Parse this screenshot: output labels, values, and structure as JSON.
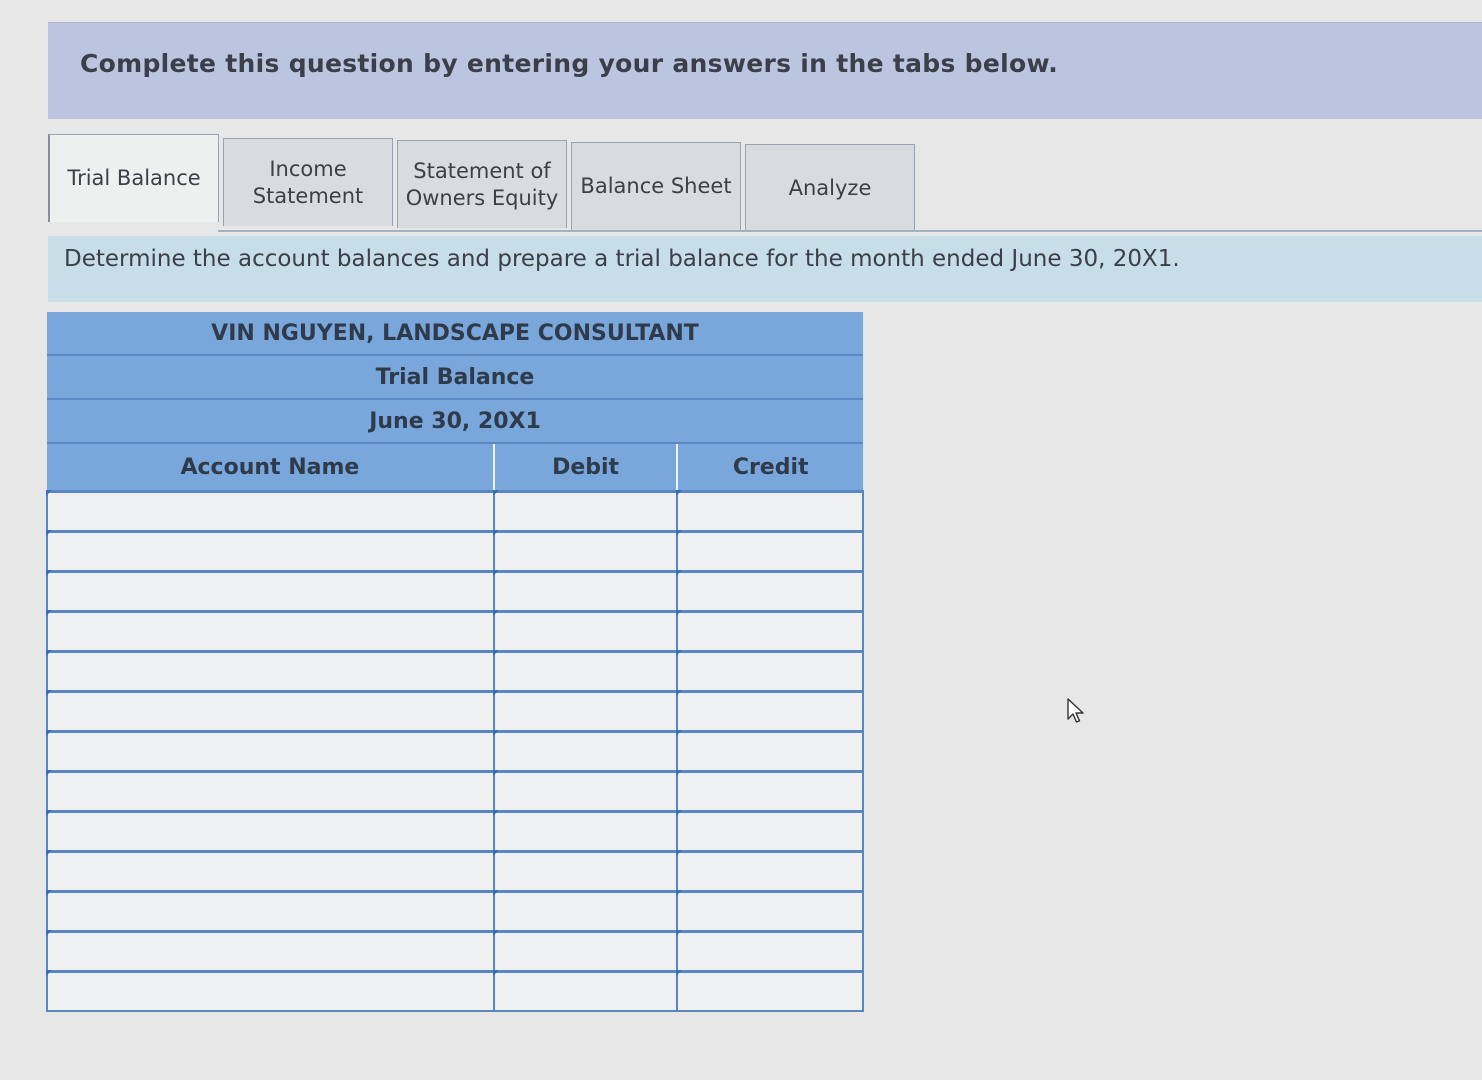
{
  "banner": {
    "text": "Complete this question by entering your answers in the tabs below."
  },
  "tabs": [
    {
      "label": "Trial Balance",
      "active": true
    },
    {
      "label": "Income\nStatement",
      "active": false
    },
    {
      "label": "Statement of\nOwners Equity",
      "active": false
    },
    {
      "label": "Balance Sheet",
      "active": false
    },
    {
      "label": "Analyze",
      "active": false
    }
  ],
  "instruction": "Determine the account balances and prepare a trial balance for the month ended June 30, 20X1.",
  "table": {
    "company": "VIN NGUYEN,  LANDSCAPE CONSULTANT",
    "title": "Trial Balance",
    "date": "June 30, 20X1",
    "columns": [
      "Account Name",
      "Debit",
      "Credit"
    ],
    "rows": [
      [
        "",
        "",
        ""
      ],
      [
        "",
        "",
        ""
      ],
      [
        "",
        "",
        ""
      ],
      [
        "",
        "",
        ""
      ],
      [
        "",
        "",
        ""
      ],
      [
        "",
        "",
        ""
      ],
      [
        "",
        "",
        ""
      ],
      [
        "",
        "",
        ""
      ],
      [
        "",
        "",
        ""
      ],
      [
        "",
        "",
        ""
      ],
      [
        "",
        "",
        ""
      ],
      [
        "",
        "",
        ""
      ],
      [
        "",
        "",
        ""
      ]
    ]
  },
  "colors": {
    "banner": "#bcc5df",
    "instruction_bar": "#c7dde8",
    "table_header": "#7aa7db",
    "grid_line": "#5b87c0"
  },
  "icons": {
    "cursor": "mouse-pointer-icon"
  }
}
